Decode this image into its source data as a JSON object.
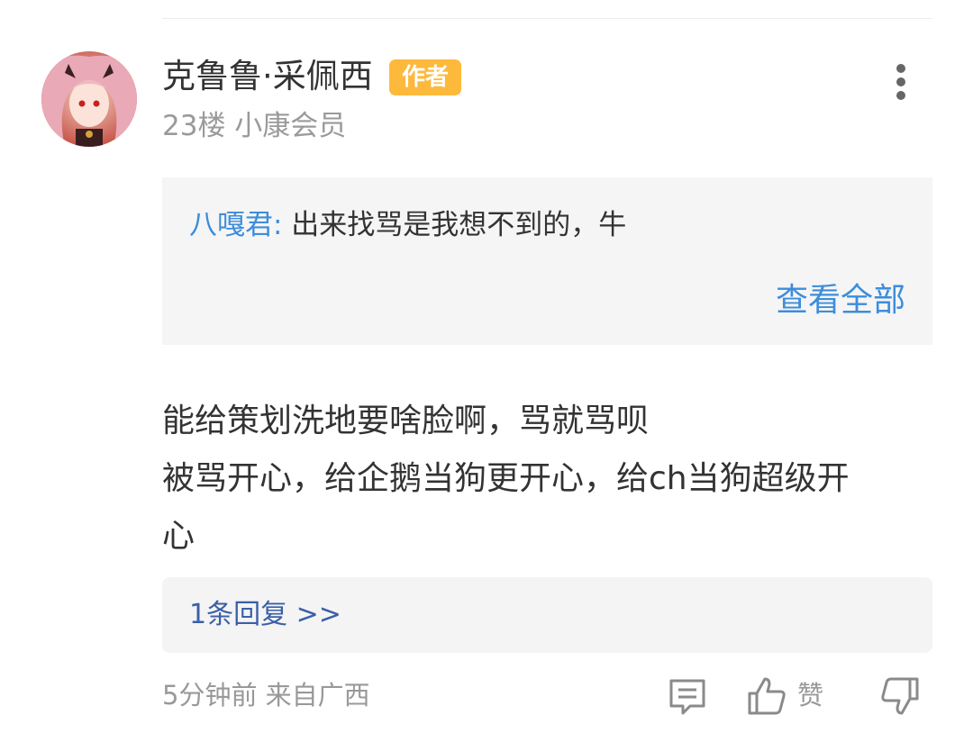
{
  "comment": {
    "username": "克鲁鲁·采佩西",
    "author_badge": "作者",
    "floor_meta": "23楼 小康会员",
    "quote": {
      "author": "八嘎君:",
      "text": " 出来找骂是我想不到的，牛",
      "view_all": "查看全部"
    },
    "content_lines": [
      "能给策划洗地要啥脸啊，骂就骂呗",
      "被骂开心，给企鹅当狗更开心，给ch当狗超级开",
      "心"
    ],
    "replies_link": "1条回复 >>",
    "footer_meta": "5分钟前 来自广西",
    "like_label": "赞"
  },
  "icons": {
    "more": "more-vertical-icon",
    "comment": "comment-icon",
    "like": "thumbs-up-icon",
    "dislike": "thumbs-down-icon"
  },
  "colors": {
    "badge": "#fdb93c",
    "link_blue": "#3d8ddb",
    "reply_blue": "#3b5fa8",
    "meta_gray": "#999999"
  }
}
